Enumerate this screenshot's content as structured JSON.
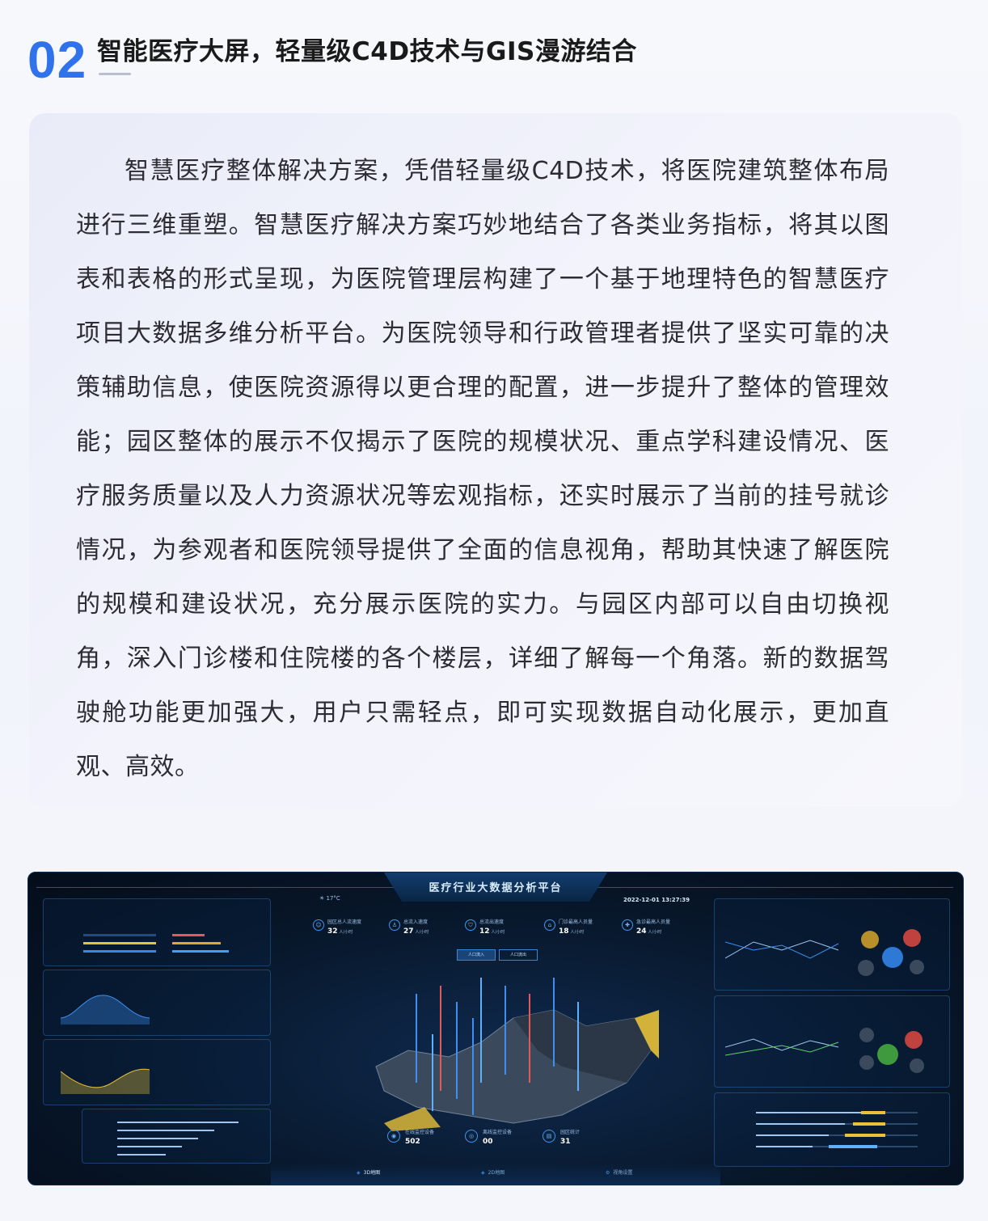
{
  "header": {
    "number": "02",
    "title": "智能医疗大屏，轻量级C4D技术与GIS漫游结合"
  },
  "intro": {
    "text": "智慧医疗整体解决方案，凭借轻量级C4D技术，将医院建筑整体布局进行三维重塑。智慧医疗解决方案巧妙地结合了各类业务指标，将其以图表和表格的形式呈现，为医院管理层构建了一个基于地理特色的智慧医疗项目大数据多维分析平台。为医院领导和行政管理者提供了坚实可靠的决策辅助信息，使医院资源得以更合理的配置，进一步提升了整体的管理效能；园区整体的展示不仅揭示了医院的规模状况、重点学科建设情况、医疗服务质量以及人力资源状况等宏观指标，还实时展示了当前的挂号就诊情况，为参观者和医院领导提供了全面的信息视角，帮助其快速了解医院的规模和建设状况，充分展示医院的实力。与园区内部可以自由切换视角，深入门诊楼和住院楼的各个楼层，详细了解每一个角落。新的数据驾驶舱功能更加强大，用户只需轻点，即可实现数据自动化展示，更加直观、高效。"
  },
  "dashboard": {
    "title": "医疗行业大数据分析平台",
    "weather": "17°C",
    "datetime": "2022-12-01  13:27:39",
    "top_stats": [
      {
        "label": "园区总人流速度",
        "value": "32",
        "unit": "人/小时"
      },
      {
        "label": "总流入速度",
        "value": "27",
        "unit": "人/小时"
      },
      {
        "label": "总流出速度",
        "value": "12",
        "unit": "人/小时"
      },
      {
        "label": "门诊最高人员量",
        "value": "18",
        "unit": "人/小时"
      },
      {
        "label": "急诊最高人员量",
        "value": "24",
        "unit": "人/小时"
      }
    ],
    "map_tabs": [
      "人口流入",
      "人口流出"
    ],
    "bottom_stats": [
      {
        "label": "在线监控设备",
        "value": "502"
      },
      {
        "label": "离线监控设备",
        "value": "00"
      },
      {
        "label": "园区统计",
        "value": "31"
      }
    ],
    "footer_tabs": [
      "3D地图",
      "2D地图",
      "视角设置"
    ],
    "accent": "#3d8ff0",
    "highlight": "#e9c23a"
  }
}
